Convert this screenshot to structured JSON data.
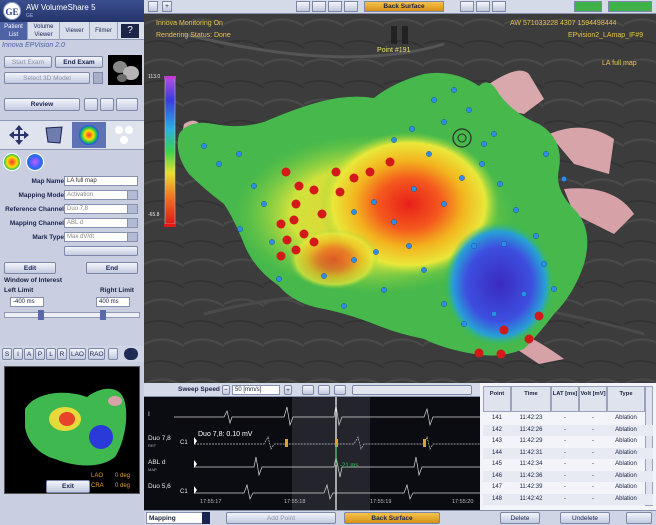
{
  "app": {
    "title": "AW VolumeShare 5",
    "subtitle": "GE",
    "logo": "GE"
  },
  "menu": [
    {
      "label": "Patient List"
    },
    {
      "label": "Volume Viewer"
    },
    {
      "label": "Viewer"
    },
    {
      "label": "Filmer"
    }
  ],
  "module": "Innova EPVision 2.0",
  "exam": {
    "start": "Start Exam",
    "end": "End Exam",
    "select_3d": "Select 3D Model"
  },
  "review": "Review",
  "map_form": {
    "map_name_label": "Map Name",
    "map_name": "LA full map",
    "mode_label": "Mapping Mode",
    "mode": "Activation",
    "ref_label": "Reference Channel",
    "ref": "Duo 7,8",
    "map_ch_label": "Mapping Channel",
    "map_ch": "ABL d",
    "mark_label": "Mark Type",
    "mark": "Max dV/dt"
  },
  "edit": "Edit",
  "end": "End",
  "interest": {
    "title": "Window of Interest",
    "left_label": "Left Limit",
    "right_label": "Right Limit",
    "left": "-400 ms",
    "right": "400 ms"
  },
  "views": [
    "S",
    "I",
    "A",
    "P",
    "L",
    "R",
    "LAO",
    "RAO"
  ],
  "thumbnail": {
    "lao": "LAO",
    "lao_val": "0 deg",
    "cra": "CRA",
    "cra_val": "0 deg"
  },
  "exit": "Exit",
  "toolbar": {
    "back_surface": "Back Surface"
  },
  "overlay": {
    "line1": "Innova Monitoring On",
    "line2": "Rendering Status: Done",
    "point": "Point #191",
    "patient": "AW 571033228 4307 1594498444",
    "study": "EPvision2_LAmap_IF#9",
    "map": "LA full map"
  },
  "colorbar": {
    "top": "113.0",
    "bottom": "-65.8"
  },
  "ecg": {
    "sweep_label": "Sweep Speed",
    "sweep_val": "50 [mm/s]",
    "readout": "Duo 7,8: 0.10 mV",
    "channels": [
      {
        "name": "I",
        "tag": ""
      },
      {
        "name": "Duo 7,8",
        "tag": "REF"
      },
      {
        "name": "ABL d",
        "tag": "MAP"
      },
      {
        "name": "Duo 5,6",
        "tag": ""
      }
    ],
    "c1": "C1",
    "delta": "-21 ms",
    "times": [
      "17:55:17",
      "17:55:18",
      "17:55:19",
      "17:55:20"
    ]
  },
  "points_table": {
    "headers": [
      "Point",
      "Time",
      "LAT [ms]",
      "Volt [mV]",
      "Type"
    ],
    "rows": [
      [
        "141",
        "11:42:23",
        "-",
        "-",
        "Ablation"
      ],
      [
        "142",
        "11:42:26",
        "-",
        "-",
        "Ablation"
      ],
      [
        "143",
        "11:42:29",
        "-",
        "-",
        "Ablation"
      ],
      [
        "144",
        "11:42:31",
        "-",
        "-",
        "Ablation"
      ],
      [
        "145",
        "11:42:34",
        "-",
        "-",
        "Ablation"
      ],
      [
        "146",
        "11:42:36",
        "-",
        "-",
        "Ablation"
      ],
      [
        "147",
        "11:42:39",
        "-",
        "-",
        "Ablation"
      ],
      [
        "148",
        "11:42:42",
        "-",
        "-",
        "Ablation"
      ]
    ]
  },
  "footer": {
    "mapping": "Mapping",
    "add_point": "Add Point",
    "back_surface": "Back Surface",
    "delete": "Delete",
    "undelete": "Undelete"
  }
}
